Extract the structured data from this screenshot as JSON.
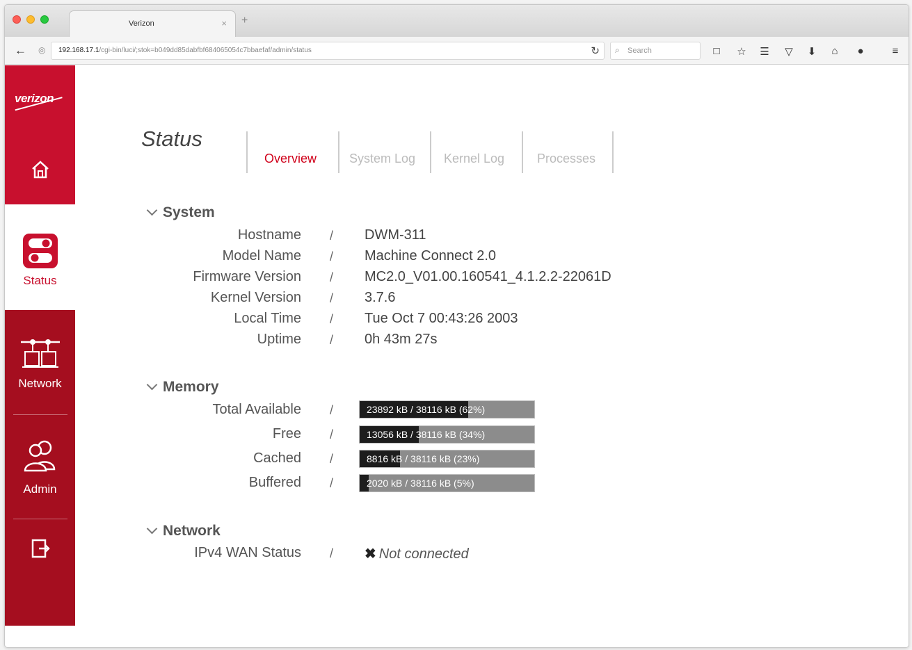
{
  "browser": {
    "tab_title": "Verizon",
    "tab_close": "×",
    "new_tab": "+",
    "url_host": "192.168.17.1",
    "url_path": "/cgi-bin/luci/;stok=b049dd85dabfbf684065054c7bbaefaf/admin/status",
    "search_placeholder": "Search"
  },
  "sidebar": {
    "logo": "verizon",
    "items": [
      {
        "label": "Status",
        "icon": "toggle-icon"
      },
      {
        "label": "Network",
        "icon": "network-icon"
      },
      {
        "label": "Admin",
        "icon": "users-icon"
      }
    ]
  },
  "page": {
    "title": "Status",
    "tabs": [
      {
        "label": "Overview",
        "active": true
      },
      {
        "label": "System Log",
        "active": false
      },
      {
        "label": "Kernel Log",
        "active": false
      },
      {
        "label": "Processes",
        "active": false
      }
    ]
  },
  "separator": "/",
  "system": {
    "heading": "System",
    "rows": [
      {
        "label": "Hostname",
        "value": "DWM-311"
      },
      {
        "label": "Model Name",
        "value": "Machine Connect 2.0"
      },
      {
        "label": "Firmware Version",
        "value": "MC2.0_V01.00.160541_4.1.2.2-22061D"
      },
      {
        "label": "Kernel Version",
        "value": "3.7.6"
      },
      {
        "label": "Local Time",
        "value": "Tue Oct 7 00:43:26 2003"
      },
      {
        "label": "Uptime",
        "value": "0h 43m 27s"
      }
    ]
  },
  "memory": {
    "heading": "Memory",
    "rows": [
      {
        "label": "Total Available",
        "text": "23892 kB / 38116 kB (62%)",
        "percent": 62
      },
      {
        "label": "Free",
        "text": "13056 kB / 38116 kB (34%)",
        "percent": 34
      },
      {
        "label": "Cached",
        "text": "8816 kB / 38116 kB (23%)",
        "percent": 23
      },
      {
        "label": "Buffered",
        "text": "2020 kB / 38116 kB (5%)",
        "percent": 5
      }
    ]
  },
  "network": {
    "heading": "Network",
    "rows": [
      {
        "label": "IPv4 WAN Status",
        "icon": "✖",
        "value": "Not connected"
      }
    ]
  },
  "colors": {
    "brand_red": "#c8102e",
    "sidebar_dark": "#a50e1f",
    "active_tab": "#d0021b"
  }
}
